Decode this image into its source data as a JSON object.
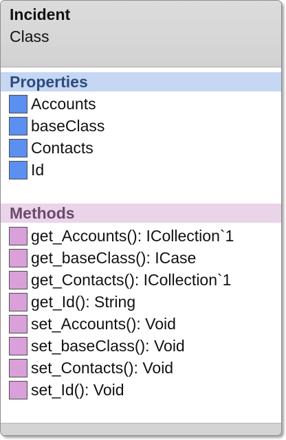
{
  "header": {
    "title": "Incident",
    "subtitle": "Class"
  },
  "colors": {
    "property_icon": "#5b8ff0",
    "method_icon": "#d9a0d9",
    "properties_band": "#c6d7f3",
    "methods_band": "#ead4ea",
    "header_background": "#d6d6d6"
  },
  "sections": {
    "properties": {
      "label": "Properties",
      "items": [
        {
          "label": "Accounts",
          "icon": "property-icon"
        },
        {
          "label": "baseClass",
          "icon": "property-icon"
        },
        {
          "label": "Contacts",
          "icon": "property-icon"
        },
        {
          "label": "Id",
          "icon": "property-icon"
        }
      ]
    },
    "methods": {
      "label": "Methods",
      "items": [
        {
          "label": "get_Accounts(): ICollection`1",
          "icon": "method-icon"
        },
        {
          "label": "get_baseClass(): ICase",
          "icon": "method-icon"
        },
        {
          "label": "get_Contacts(): ICollection`1",
          "icon": "method-icon"
        },
        {
          "label": "get_Id(): String",
          "icon": "method-icon"
        },
        {
          "label": "set_Accounts(): Void",
          "icon": "method-icon"
        },
        {
          "label": "set_baseClass(): Void",
          "icon": "method-icon"
        },
        {
          "label": "set_Contacts(): Void",
          "icon": "method-icon"
        },
        {
          "label": "set_Id(): Void",
          "icon": "method-icon"
        }
      ]
    }
  }
}
